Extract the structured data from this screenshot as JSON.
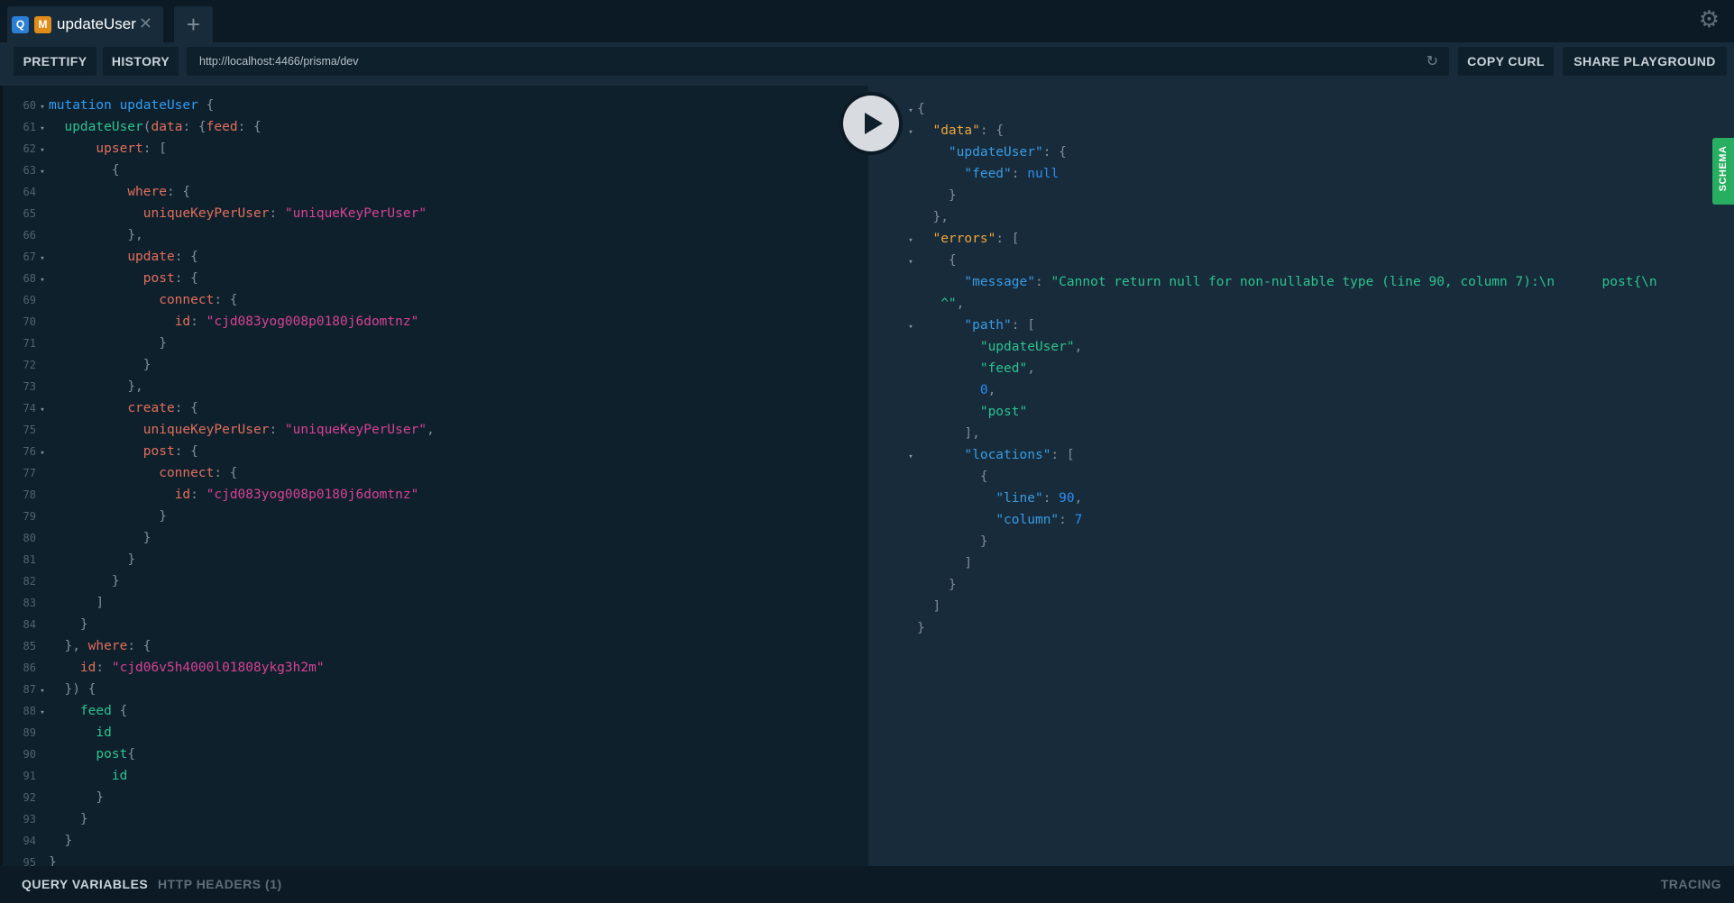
{
  "tabs": [
    {
      "badges": [
        "Q",
        "M"
      ],
      "title": "updateUser",
      "close": "✕"
    }
  ],
  "tab_add": "+",
  "toolbar": {
    "prettify": "PRETTIFY",
    "history": "HISTORY",
    "url": "http://localhost:4466/prisma/dev",
    "copy_curl": "COPY CURL",
    "share": "SHARE PLAYGROUND"
  },
  "query_lines": [
    {
      "n": "60",
      "fold": true,
      "indent": 0,
      "segs": [
        [
          "k",
          "mutation "
        ],
        [
          "k",
          "updateUser"
        ],
        [
          "p",
          " {"
        ]
      ]
    },
    {
      "n": "61",
      "fold": true,
      "indent": 2,
      "segs": [
        [
          "g",
          "updateUser"
        ],
        [
          "p",
          "("
        ],
        [
          "f",
          "data"
        ],
        [
          "p",
          ": {"
        ],
        [
          "f",
          "feed"
        ],
        [
          "p",
          ": {"
        ]
      ]
    },
    {
      "n": "62",
      "fold": true,
      "indent": 6,
      "segs": [
        [
          "f",
          "upsert"
        ],
        [
          "p",
          ": ["
        ]
      ]
    },
    {
      "n": "63",
      "fold": true,
      "indent": 8,
      "segs": [
        [
          "p",
          "{"
        ]
      ]
    },
    {
      "n": "64",
      "fold": false,
      "indent": 10,
      "segs": [
        [
          "f",
          "where"
        ],
        [
          "p",
          ": {"
        ]
      ]
    },
    {
      "n": "65",
      "fold": false,
      "indent": 12,
      "segs": [
        [
          "f",
          "uniqueKeyPerUser"
        ],
        [
          "p",
          ": "
        ],
        [
          "s",
          "\"uniqueKeyPerUser\""
        ]
      ]
    },
    {
      "n": "66",
      "fold": false,
      "indent": 10,
      "segs": [
        [
          "p",
          "},"
        ]
      ]
    },
    {
      "n": "67",
      "fold": true,
      "indent": 10,
      "segs": [
        [
          "f",
          "update"
        ],
        [
          "p",
          ": {"
        ]
      ]
    },
    {
      "n": "68",
      "fold": true,
      "indent": 12,
      "segs": [
        [
          "f",
          "post"
        ],
        [
          "p",
          ": {"
        ]
      ]
    },
    {
      "n": "69",
      "fold": false,
      "indent": 14,
      "segs": [
        [
          "f",
          "connect"
        ],
        [
          "p",
          ": {"
        ]
      ]
    },
    {
      "n": "70",
      "fold": false,
      "indent": 16,
      "segs": [
        [
          "f",
          "id"
        ],
        [
          "p",
          ": "
        ],
        [
          "s",
          "\"cjd083yog008p0180j6domtnz\""
        ]
      ]
    },
    {
      "n": "71",
      "fold": false,
      "indent": 14,
      "segs": [
        [
          "p",
          "}"
        ]
      ]
    },
    {
      "n": "72",
      "fold": false,
      "indent": 12,
      "segs": [
        [
          "p",
          "}"
        ]
      ]
    },
    {
      "n": "73",
      "fold": false,
      "indent": 10,
      "segs": [
        [
          "p",
          "},"
        ]
      ]
    },
    {
      "n": "74",
      "fold": true,
      "indent": 10,
      "segs": [
        [
          "f",
          "create"
        ],
        [
          "p",
          ": {"
        ]
      ]
    },
    {
      "n": "75",
      "fold": false,
      "indent": 12,
      "segs": [
        [
          "f",
          "uniqueKeyPerUser"
        ],
        [
          "p",
          ": "
        ],
        [
          "s",
          "\"uniqueKeyPerUser\""
        ],
        [
          "p",
          ","
        ]
      ]
    },
    {
      "n": "76",
      "fold": true,
      "indent": 12,
      "segs": [
        [
          "f",
          "post"
        ],
        [
          "p",
          ": {"
        ]
      ]
    },
    {
      "n": "77",
      "fold": false,
      "indent": 14,
      "segs": [
        [
          "f",
          "connect"
        ],
        [
          "p",
          ": {"
        ]
      ]
    },
    {
      "n": "78",
      "fold": false,
      "indent": 16,
      "segs": [
        [
          "f",
          "id"
        ],
        [
          "p",
          ": "
        ],
        [
          "s",
          "\"cjd083yog008p0180j6domtnz\""
        ]
      ]
    },
    {
      "n": "79",
      "fold": false,
      "indent": 14,
      "segs": [
        [
          "p",
          "}"
        ]
      ]
    },
    {
      "n": "80",
      "fold": false,
      "indent": 12,
      "segs": [
        [
          "p",
          "}"
        ]
      ]
    },
    {
      "n": "81",
      "fold": false,
      "indent": 10,
      "segs": [
        [
          "p",
          "}"
        ]
      ]
    },
    {
      "n": "82",
      "fold": false,
      "indent": 8,
      "segs": [
        [
          "p",
          "}"
        ]
      ]
    },
    {
      "n": "83",
      "fold": false,
      "indent": 6,
      "segs": [
        [
          "p",
          "]"
        ]
      ]
    },
    {
      "n": "84",
      "fold": false,
      "indent": 4,
      "segs": [
        [
          "p",
          "}"
        ]
      ]
    },
    {
      "n": "85",
      "fold": false,
      "indent": 2,
      "segs": [
        [
          "p",
          "}, "
        ],
        [
          "f",
          "where"
        ],
        [
          "p",
          ": {"
        ]
      ]
    },
    {
      "n": "86",
      "fold": false,
      "indent": 4,
      "segs": [
        [
          "f",
          "id"
        ],
        [
          "p",
          ": "
        ],
        [
          "s",
          "\"cjd06v5h4000l01808ykg3h2m\""
        ]
      ]
    },
    {
      "n": "87",
      "fold": true,
      "indent": 2,
      "segs": [
        [
          "p",
          "}) {"
        ]
      ]
    },
    {
      "n": "88",
      "fold": true,
      "indent": 4,
      "segs": [
        [
          "g",
          "feed"
        ],
        [
          "p",
          " {"
        ]
      ]
    },
    {
      "n": "89",
      "fold": false,
      "indent": 6,
      "segs": [
        [
          "g",
          "id"
        ]
      ]
    },
    {
      "n": "90",
      "fold": false,
      "indent": 6,
      "segs": [
        [
          "g",
          "post"
        ],
        [
          "p",
          "{"
        ]
      ]
    },
    {
      "n": "91",
      "fold": false,
      "indent": 8,
      "segs": [
        [
          "g",
          "id"
        ]
      ]
    },
    {
      "n": "92",
      "fold": false,
      "indent": 6,
      "segs": [
        [
          "p",
          "}"
        ]
      ]
    },
    {
      "n": "93",
      "fold": false,
      "indent": 4,
      "segs": [
        [
          "p",
          "}"
        ]
      ]
    },
    {
      "n": "94",
      "fold": false,
      "indent": 2,
      "segs": [
        [
          "p",
          "}"
        ]
      ]
    },
    {
      "n": "95",
      "fold": false,
      "indent": 0,
      "segs": [
        [
          "p",
          "}"
        ]
      ]
    }
  ],
  "result_lines": [
    {
      "fold": true,
      "indent": 0,
      "segs": [
        [
          "p",
          "{"
        ]
      ]
    },
    {
      "fold": true,
      "indent": 2,
      "segs": [
        [
          "ro",
          "\"data\""
        ],
        [
          "p",
          ": {"
        ]
      ]
    },
    {
      "fold": false,
      "indent": 4,
      "segs": [
        [
          "rk",
          "\"updateUser\""
        ],
        [
          "p",
          ": {"
        ]
      ]
    },
    {
      "fold": false,
      "indent": 6,
      "segs": [
        [
          "rk",
          "\"feed\""
        ],
        [
          "p",
          ": "
        ],
        [
          "rn",
          "null"
        ]
      ]
    },
    {
      "fold": false,
      "indent": 4,
      "segs": [
        [
          "p",
          "}"
        ]
      ]
    },
    {
      "fold": false,
      "indent": 2,
      "segs": [
        [
          "p",
          "},"
        ]
      ]
    },
    {
      "fold": true,
      "indent": 2,
      "segs": [
        [
          "ro",
          "\"errors\""
        ],
        [
          "p",
          ": ["
        ]
      ]
    },
    {
      "fold": true,
      "indent": 4,
      "segs": [
        [
          "p",
          "{"
        ]
      ]
    },
    {
      "fold": false,
      "indent": 6,
      "segs": [
        [
          "rk",
          "\"message\""
        ],
        [
          "p",
          ": "
        ],
        [
          "rs",
          "\"Cannot return null for non-nullable type (line 90, column 7):\\n      post{\\n"
        ]
      ]
    },
    {
      "fold": false,
      "indent": 3,
      "segs": [
        [
          "rs",
          "^\""
        ],
        [
          "p",
          ","
        ]
      ]
    },
    {
      "fold": true,
      "indent": 6,
      "segs": [
        [
          "rk",
          "\"path\""
        ],
        [
          "p",
          ": ["
        ]
      ]
    },
    {
      "fold": false,
      "indent": 8,
      "segs": [
        [
          "rs",
          "\"updateUser\""
        ],
        [
          "p",
          ","
        ]
      ]
    },
    {
      "fold": false,
      "indent": 8,
      "segs": [
        [
          "rs",
          "\"feed\""
        ],
        [
          "p",
          ","
        ]
      ]
    },
    {
      "fold": false,
      "indent": 8,
      "segs": [
        [
          "rn",
          "0"
        ],
        [
          "p",
          ","
        ]
      ]
    },
    {
      "fold": false,
      "indent": 8,
      "segs": [
        [
          "rs",
          "\"post\""
        ]
      ]
    },
    {
      "fold": false,
      "indent": 6,
      "segs": [
        [
          "p",
          "],"
        ]
      ]
    },
    {
      "fold": true,
      "indent": 6,
      "segs": [
        [
          "rk",
          "\"locations\""
        ],
        [
          "p",
          ": ["
        ]
      ]
    },
    {
      "fold": false,
      "indent": 8,
      "segs": [
        [
          "p",
          "{"
        ]
      ]
    },
    {
      "fold": false,
      "indent": 10,
      "segs": [
        [
          "rk",
          "\"line\""
        ],
        [
          "p",
          ": "
        ],
        [
          "rn",
          "90"
        ],
        [
          "p",
          ","
        ]
      ]
    },
    {
      "fold": false,
      "indent": 10,
      "segs": [
        [
          "rk",
          "\"column\""
        ],
        [
          "p",
          ": "
        ],
        [
          "rn",
          "7"
        ]
      ]
    },
    {
      "fold": false,
      "indent": 8,
      "segs": [
        [
          "p",
          "}"
        ]
      ]
    },
    {
      "fold": false,
      "indent": 6,
      "segs": [
        [
          "p",
          "]"
        ]
      ]
    },
    {
      "fold": false,
      "indent": 4,
      "segs": [
        [
          "p",
          "}"
        ]
      ]
    },
    {
      "fold": false,
      "indent": 2,
      "segs": [
        [
          "p",
          "]"
        ]
      ]
    },
    {
      "fold": false,
      "indent": 0,
      "segs": [
        [
          "p",
          "}"
        ]
      ]
    }
  ],
  "schema_label": "SCHEMA",
  "bottom": {
    "query_variables": "QUERY VARIABLES",
    "http_headers": "HTTP HEADERS (1)",
    "tracing": "TRACING"
  },
  "icons": {
    "gear": "⚙",
    "reload": "↻",
    "fold": "▾"
  }
}
